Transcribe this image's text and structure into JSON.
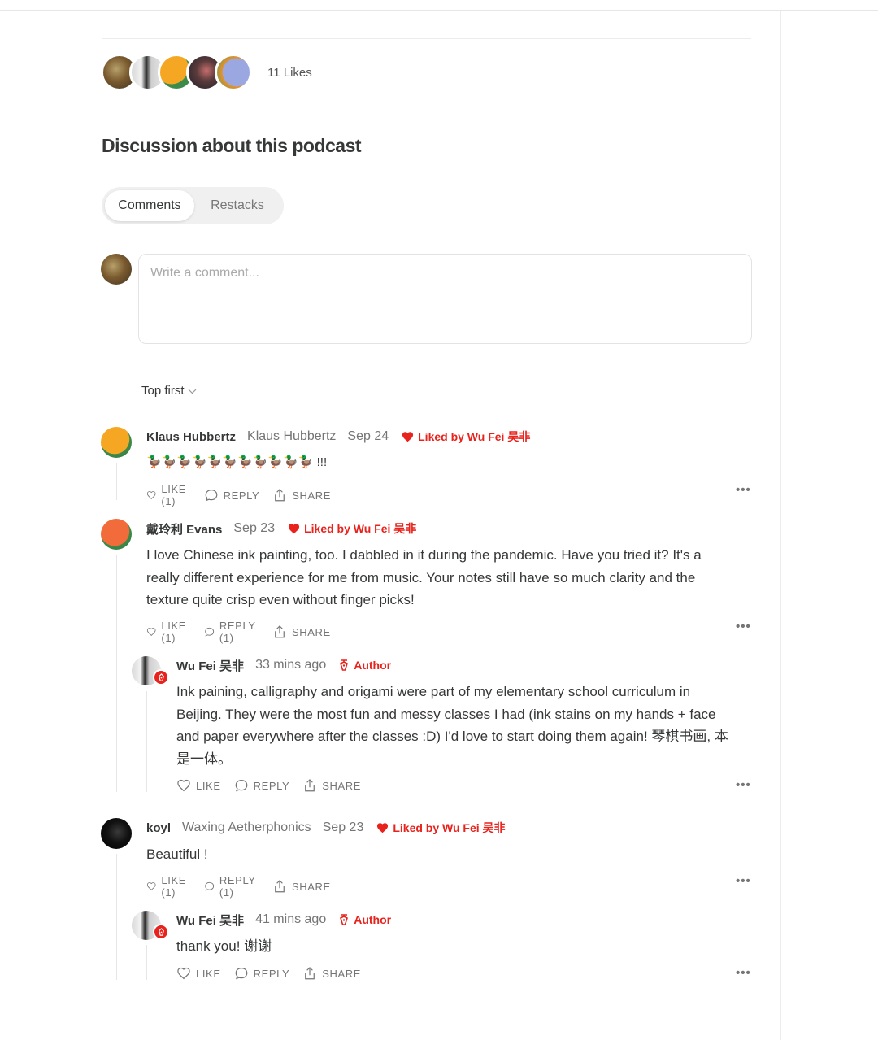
{
  "likes": {
    "count_label": "11 Likes"
  },
  "discussion": {
    "heading": "Discussion about this podcast",
    "tabs": [
      {
        "label": "Comments"
      },
      {
        "label": "Restacks"
      }
    ],
    "comment_placeholder": "Write a comment...",
    "sort_label": "Top first"
  },
  "actions": {
    "like": "LIKE",
    "reply": "REPLY",
    "share": "SHARE",
    "more": "•••"
  },
  "comments": [
    {
      "name": "Klaus Hubbertz",
      "handle": "Klaus Hubbertz",
      "date": "Sep 24",
      "liked_by": "Liked by Wu Fei 吴非",
      "text": "🦆🦆🦆🦆🦆🦆🦆🦆🦆🦆🦆 !!!",
      "like_label": "LIKE (1)",
      "reply_label": "REPLY",
      "share_label": "SHARE"
    },
    {
      "name": "戴玲利 Evans",
      "date": "Sep 23",
      "liked_by": "Liked by Wu Fei 吴非",
      "text": "I love Chinese ink painting, too. I dabbled in it during the pandemic. Have you tried it? It's a really different experience for me from music. Your notes still have so much clarity and the texture quite crisp even without finger picks!",
      "like_label": "LIKE (1)",
      "reply_label": "REPLY (1)",
      "share_label": "SHARE",
      "reply": {
        "name": "Wu Fei 吴非",
        "date": "33 mins ago",
        "badge": "Author",
        "text": "Ink paining, calligraphy and origami were part of my elementary school curriculum in Beijing. They were the most fun and messy classes I had (ink stains on my hands + face and paper everywhere after the classes :D) I'd love to start doing them again! 琴棋书画, 本是一体。",
        "like_label": "LIKE",
        "reply_label": "REPLY",
        "share_label": "SHARE"
      }
    },
    {
      "name": "koyl",
      "handle": "Waxing Aetherphonics",
      "date": "Sep 23",
      "liked_by": "Liked by Wu Fei 吴非",
      "text": "Beautiful !",
      "like_label": "LIKE (1)",
      "reply_label": "REPLY (1)",
      "share_label": "SHARE",
      "reply": {
        "name": "Wu Fei 吴非",
        "date": "41 mins ago",
        "badge": "Author",
        "text": "thank you! 谢谢",
        "like_label": "LIKE",
        "reply_label": "REPLY",
        "share_label": "SHARE"
      }
    }
  ],
  "colors": {
    "accent_red": "#e8221c",
    "text": "#363737",
    "muted": "#757575"
  }
}
